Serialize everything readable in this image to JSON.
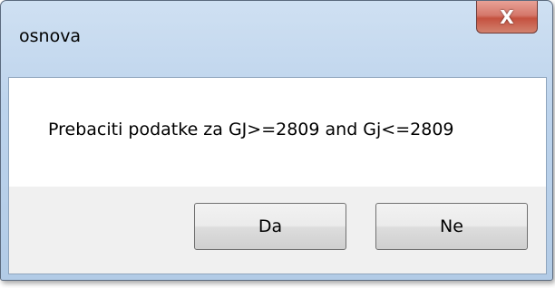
{
  "window": {
    "title": "osnova",
    "close_glyph": "X"
  },
  "dialog": {
    "message": "Prebaciti podatke za GJ>=2809 and Gj<=2809",
    "buttons": {
      "yes_label": "Da",
      "no_label": "Ne"
    }
  },
  "colors": {
    "frame": "#bcd3ec",
    "close_button": "#c5513f",
    "client_background": "#f0f0f0",
    "message_background": "#ffffff"
  }
}
